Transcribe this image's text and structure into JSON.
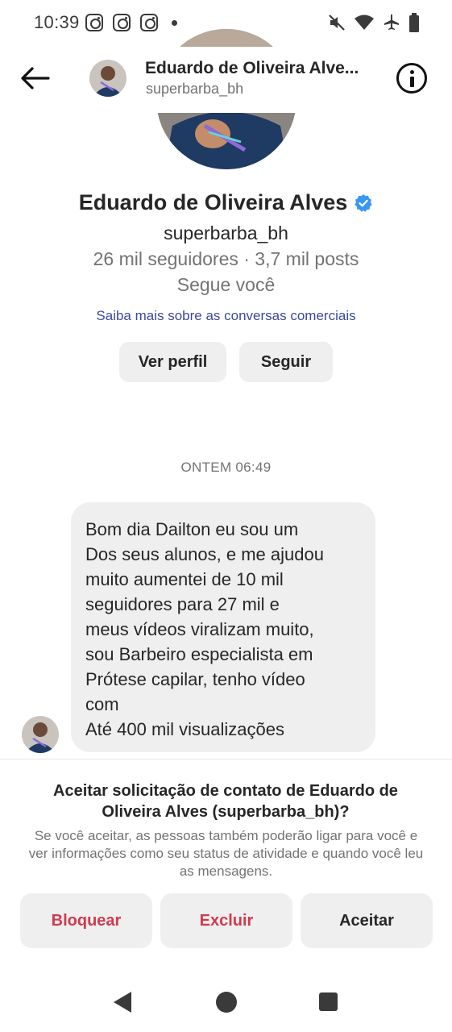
{
  "status_bar": {
    "time": "10:39",
    "icons": [
      "instagram-icon",
      "instagram-icon",
      "instagram-icon",
      "dot-icon",
      "mute-icon",
      "wifi-icon",
      "airplane-icon",
      "battery-icon"
    ]
  },
  "header": {
    "name": "Eduardo de Oliveira Alve...",
    "username": "superbarba_bh"
  },
  "profile": {
    "name": "Eduardo de Oliveira Alves",
    "username": "superbarba_bh",
    "stats": "26 mil seguidores · 3,7 mil posts",
    "follows_you": "Segue você",
    "business_link": "Saiba mais sobre as conversas comerciais",
    "view_profile_label": "Ver perfil",
    "follow_label": "Seguir",
    "verified_color": "#3897f0"
  },
  "conversation": {
    "timestamp": "ONTEM 06:49",
    "message": "Bom dia Dailton eu sou um\nDos seus alunos, e me ajudou\nmuito aumentei de 10 mil\nseguidores para 27 mil e\nmeus vídeos viralizam muito,\nsou Barbeiro especialista em\nPrótese capilar, tenho vídeo\ncom\nAté 400 mil visualizações"
  },
  "request": {
    "title": "Aceitar solicitação de contato de Eduardo de Oliveira Alves (superbarba_bh)?",
    "description": "Se você aceitar, as pessoas também poderão ligar para você e ver informações como seu status de atividade e quando você leu as mensagens.",
    "block_label": "Bloquear",
    "delete_label": "Excluir",
    "accept_label": "Aceitar",
    "danger_color": "#d03a4e"
  }
}
